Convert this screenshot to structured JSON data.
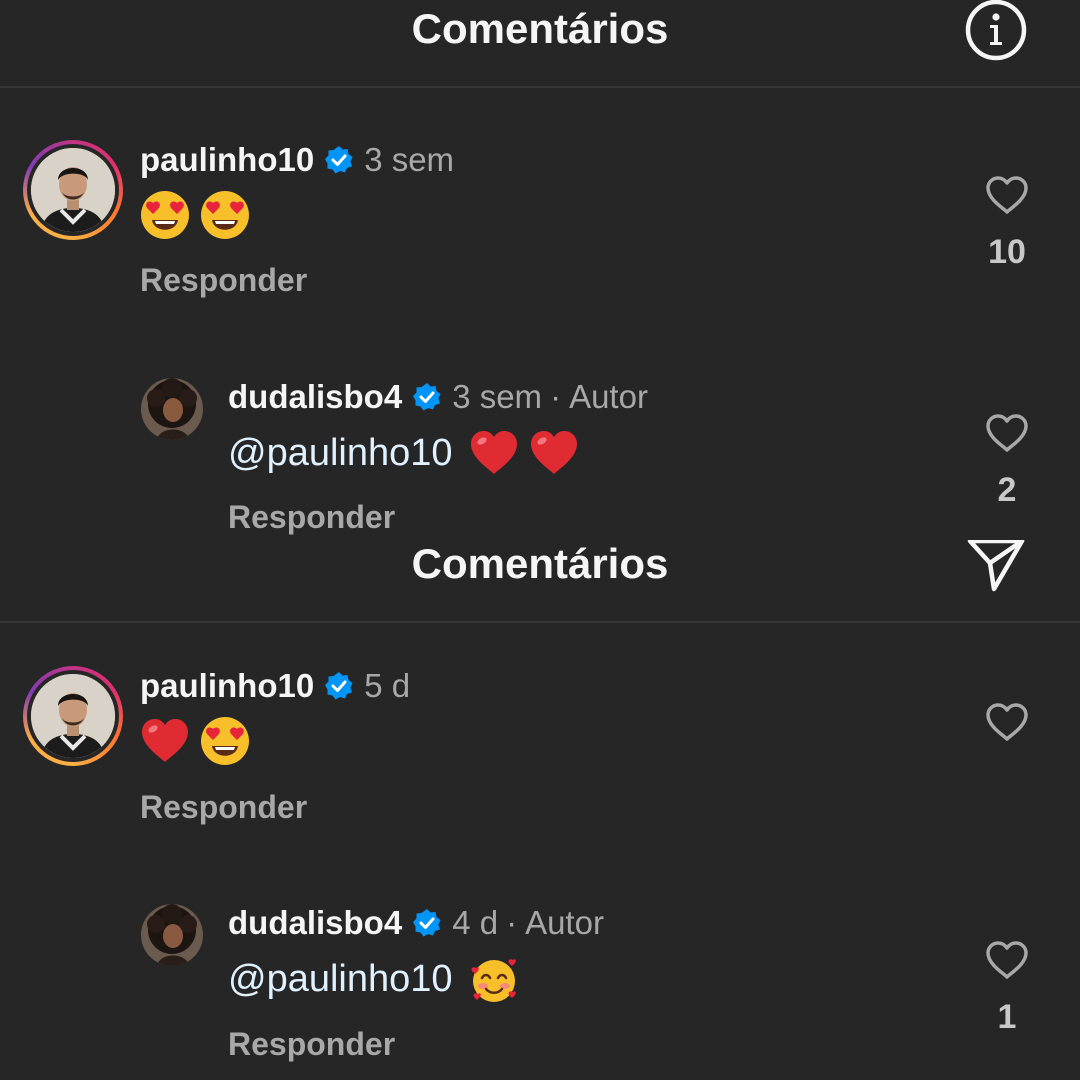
{
  "colors": {
    "background": "#262626",
    "secondary_text": "#a8a8a8",
    "verified_blue": "#0095f6",
    "mention": "#e0f1ff"
  },
  "panels": [
    {
      "header": {
        "title": "Comentários",
        "action_icon": "info-icon"
      },
      "comment": {
        "username": "paulinho10",
        "verified": true,
        "time": "3 sem",
        "emojis": [
          "heart-eyes-emoji",
          "heart-eyes-emoji"
        ],
        "reply_label": "Responder",
        "likes": "10"
      },
      "reply": {
        "username": "dudalisbo4",
        "verified": true,
        "time": "3 sem",
        "separator": "·",
        "author_badge": "Autor",
        "mention": "@paulinho10",
        "emojis": [
          "red-heart-emoji",
          "red-heart-emoji"
        ],
        "reply_label": "Responder",
        "likes": "2"
      }
    },
    {
      "header": {
        "title": "Comentários",
        "action_icon": "send-icon"
      },
      "comment": {
        "username": "paulinho10",
        "verified": true,
        "time": "5 d",
        "emojis": [
          "red-heart-emoji",
          "heart-eyes-emoji"
        ],
        "reply_label": "Responder",
        "likes": ""
      },
      "reply": {
        "username": "dudalisbo4",
        "verified": true,
        "time": "4 d",
        "separator": "·",
        "author_badge": "Autor",
        "mention": "@paulinho10",
        "emojis": [
          "smiling-face-with-hearts-emoji"
        ],
        "reply_label": "Responder",
        "likes": "1"
      }
    }
  ]
}
